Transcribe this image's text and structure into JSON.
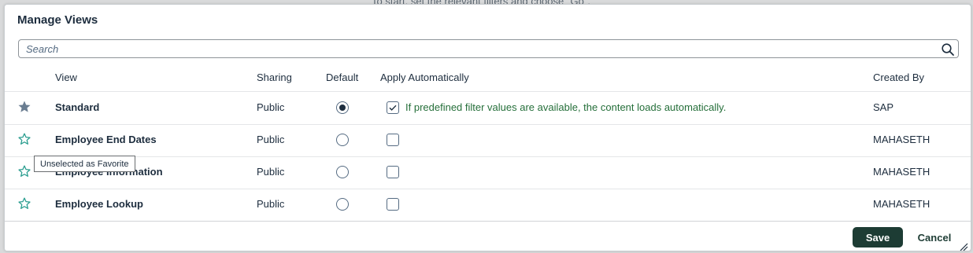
{
  "background": {
    "text": "To start, set the relevant filters and choose \"Go\"."
  },
  "dialog": {
    "title": "Manage Views",
    "search": {
      "value": "",
      "placeholder": "Search",
      "icon": "search-icon"
    },
    "columns": [
      "View",
      "Sharing",
      "Default",
      "Apply Automatically",
      "Created By"
    ],
    "rows": [
      {
        "favorite": true,
        "view": "Standard",
        "sharing": "Public",
        "default": true,
        "apply": true,
        "apply_text": "If predefined filter values are available, the content loads automatically.",
        "created_by": "SAP"
      },
      {
        "favorite": false,
        "view": "Employee End Dates",
        "sharing": "Public",
        "default": false,
        "apply": false,
        "apply_text": "",
        "created_by": "MAHASETH"
      },
      {
        "favorite": false,
        "view": "Employee Information",
        "sharing": "Public",
        "default": false,
        "apply": false,
        "apply_text": "",
        "created_by": "MAHASETH"
      },
      {
        "favorite": false,
        "view": "Employee Lookup",
        "sharing": "Public",
        "default": false,
        "apply": false,
        "apply_text": "",
        "created_by": "MAHASETH"
      }
    ],
    "tooltip": "Unselected as Favorite",
    "footer": {
      "save_label": "Save",
      "cancel_label": "Cancel"
    }
  },
  "colors": {
    "primary": "#1d3c34",
    "star_filled": "#6a7d91",
    "star_outline": "#2a9d8f",
    "apply_text": "#256f3a"
  }
}
